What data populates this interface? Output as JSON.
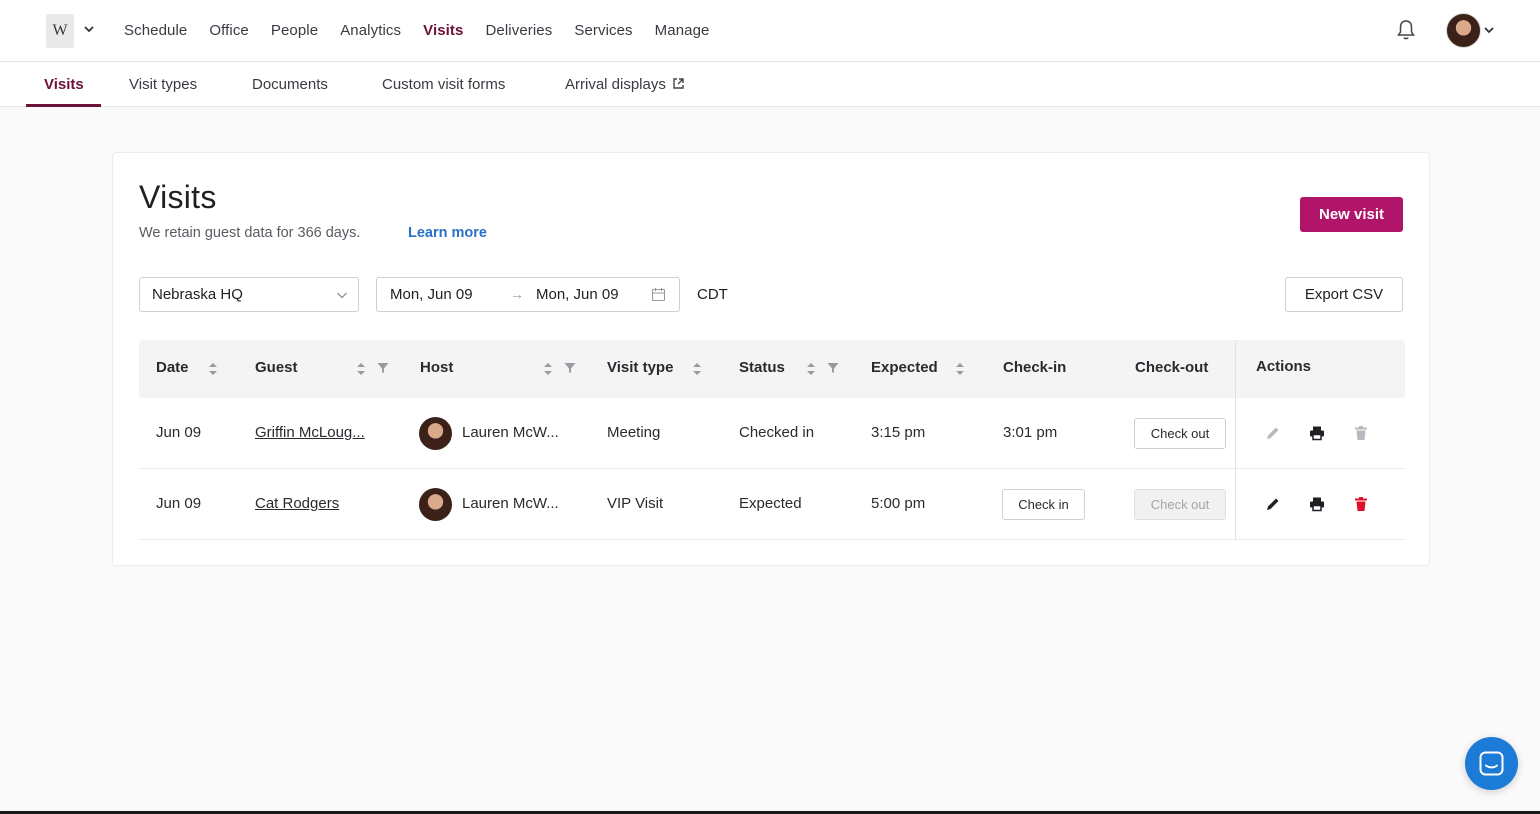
{
  "app": {
    "logo_letter": "W"
  },
  "nav": {
    "items": [
      "Schedule",
      "Office",
      "People",
      "Analytics",
      "Visits",
      "Deliveries",
      "Services",
      "Manage"
    ],
    "active": "Visits"
  },
  "subnav": {
    "tabs": [
      "Visits",
      "Visit types",
      "Documents",
      "Custom visit forms",
      "Arrival displays"
    ],
    "active": "Visits"
  },
  "page": {
    "title": "Visits",
    "retain_text": "We retain guest data for 366 days.",
    "learn_more": "Learn more",
    "new_visit": "New visit",
    "export_csv": "Export CSV"
  },
  "filters": {
    "location": "Nebraska HQ",
    "date_start": "Mon, Jun 09",
    "date_arrow": "→",
    "date_end": "Mon, Jun 09",
    "timezone": "CDT"
  },
  "table": {
    "headers": {
      "date": "Date",
      "guest": "Guest",
      "host": "Host",
      "visit_type": "Visit type",
      "status": "Status",
      "expected": "Expected",
      "check_in": "Check-in",
      "check_out": "Check-out",
      "actions": "Actions"
    },
    "rows": [
      {
        "date": "Jun 09",
        "guest": "Griffin McLoug...",
        "host": "Lauren McW...",
        "visit_type": "Meeting",
        "status": "Checked in",
        "expected": "3:15 pm",
        "check_in": "3:01 pm",
        "check_out_button": "Check out"
      },
      {
        "date": "Jun 09",
        "guest": "Cat Rodgers",
        "host": "Lauren McW...",
        "visit_type": "VIP Visit",
        "status": "Expected",
        "expected": "5:00 pm",
        "check_in_button": "Check in",
        "check_out_button": "Check out"
      }
    ]
  },
  "colors": {
    "brand": "#b0156a",
    "active_nav": "#6b1339",
    "link": "#2a70c9",
    "delete": "#e0102b",
    "chat": "#1c7bd6"
  }
}
